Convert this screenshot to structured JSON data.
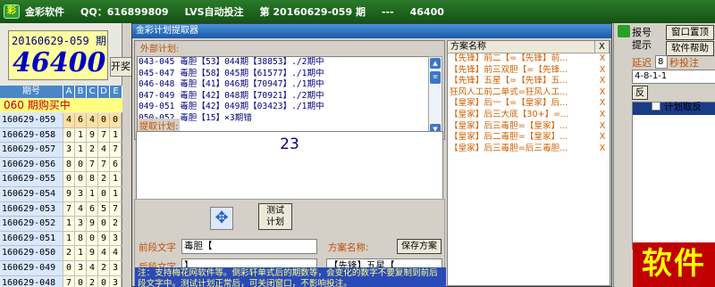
{
  "main_title": {
    "brand": "金彩软件",
    "qq": "QQ：616899809",
    "product": "LVS自动投注",
    "period": "第 20160629-059 期",
    "sep": "---",
    "number": "46400"
  },
  "left_panel": {
    "period_label": "20160629-059 期",
    "number": "46400",
    "open_button": "开奖",
    "columns": [
      "期号",
      "A",
      "B",
      "C",
      "D",
      "E"
    ],
    "hit_row": "060  期购买中",
    "rows": [
      {
        "period": "160629-059",
        "digits": [
          "4",
          "6",
          "4",
          "0",
          "0"
        ]
      },
      {
        "period": "160629-058",
        "digits": [
          "0",
          "1",
          "9",
          "7",
          "1"
        ]
      },
      {
        "period": "160629-057",
        "digits": [
          "3",
          "1",
          "2",
          "4",
          "7"
        ]
      },
      {
        "period": "160629-056",
        "digits": [
          "8",
          "0",
          "7",
          "7",
          "6"
        ]
      },
      {
        "period": "160629-055",
        "digits": [
          "0",
          "0",
          "8",
          "2",
          "1"
        ]
      },
      {
        "period": "160629-054",
        "digits": [
          "9",
          "3",
          "1",
          "0",
          "1"
        ]
      },
      {
        "period": "160629-053",
        "digits": [
          "7",
          "4",
          "6",
          "5",
          "7"
        ]
      },
      {
        "period": "160629-052",
        "digits": [
          "1",
          "3",
          "9",
          "0",
          "2"
        ]
      },
      {
        "period": "160629-051",
        "digits": [
          "1",
          "8",
          "0",
          "9",
          "3"
        ]
      },
      {
        "period": "160629-050",
        "digits": [
          "2",
          "1",
          "9",
          "4",
          "4"
        ]
      },
      {
        "period": "160629-049",
        "digits": [
          "0",
          "3",
          "4",
          "2",
          "3"
        ]
      },
      {
        "period": "160629-048",
        "digits": [
          "7",
          "0",
          "2",
          "0",
          "3"
        ]
      }
    ]
  },
  "dialog": {
    "title": "金彩计划提取器",
    "external_label": "外部计划:",
    "external_lines": [
      "043-045 毒胆【53】044期【38853】./2期中",
      "045-047 毒胆【58】045期【61577】./1期中",
      "046-048 毒胆【41】046期【70947】./1期中",
      "047-049 毒胆【42】048期【70921】./2期中",
      "049-051 毒胆【42】049期【03423】./1期中",
      "050-052 毒胆【15】×3期错"
    ],
    "extract_label": "提取计划:",
    "extract_value": "23",
    "scheme_header_name": "方案名称",
    "scheme_header_x": "X",
    "schemes": [
      "【先锋】前二【=【先锋】前...",
      "【先锋】前三双胆【=【先锋...",
      "【先锋】五星【=【先锋】五...",
      "狂风人工前二单式=狂风人工...",
      "【皇家】后一【=【皇家】后...",
      "【皇家】后三大底【30+】=...",
      "【皇家】后三毒胆=【皇家】...",
      "【皇家】后二毒胆=【皇家】...",
      "【皇家】后三毒胆=后三毒胆..."
    ],
    "test_button": "测试\n计划",
    "prefix_label": "前段文字",
    "prefix_value": "毒胆【",
    "suffix_label": "后段文字",
    "suffix_value": "】",
    "scheme_name_label": "方案名称:",
    "save_button": "保存方案",
    "scheme_name_value": "【先锋】五星【",
    "note": "注：支持梅花网软件等。倒彩轩单式后的期数等，会变化的数字不要复制到前后段文字中。测试计划正常后，可关闭窗口，不影响投注。"
  },
  "right_panel": {
    "line1": "报号",
    "line2": "提示",
    "reset_button": "窗口置顶",
    "help_button": "软件帮助",
    "delay_label": "延迟",
    "delay_value": "8",
    "second_label": "秒投注",
    "input_value": "4-8-1-1",
    "reverse_button": "反",
    "plan_reverse": "计划取反",
    "soft_label": "软件"
  },
  "colors": {
    "title_green": "#145214",
    "dialog_title": "#1a5aa8",
    "orange_text": "#d06000",
    "soft_red": "#c00000"
  }
}
